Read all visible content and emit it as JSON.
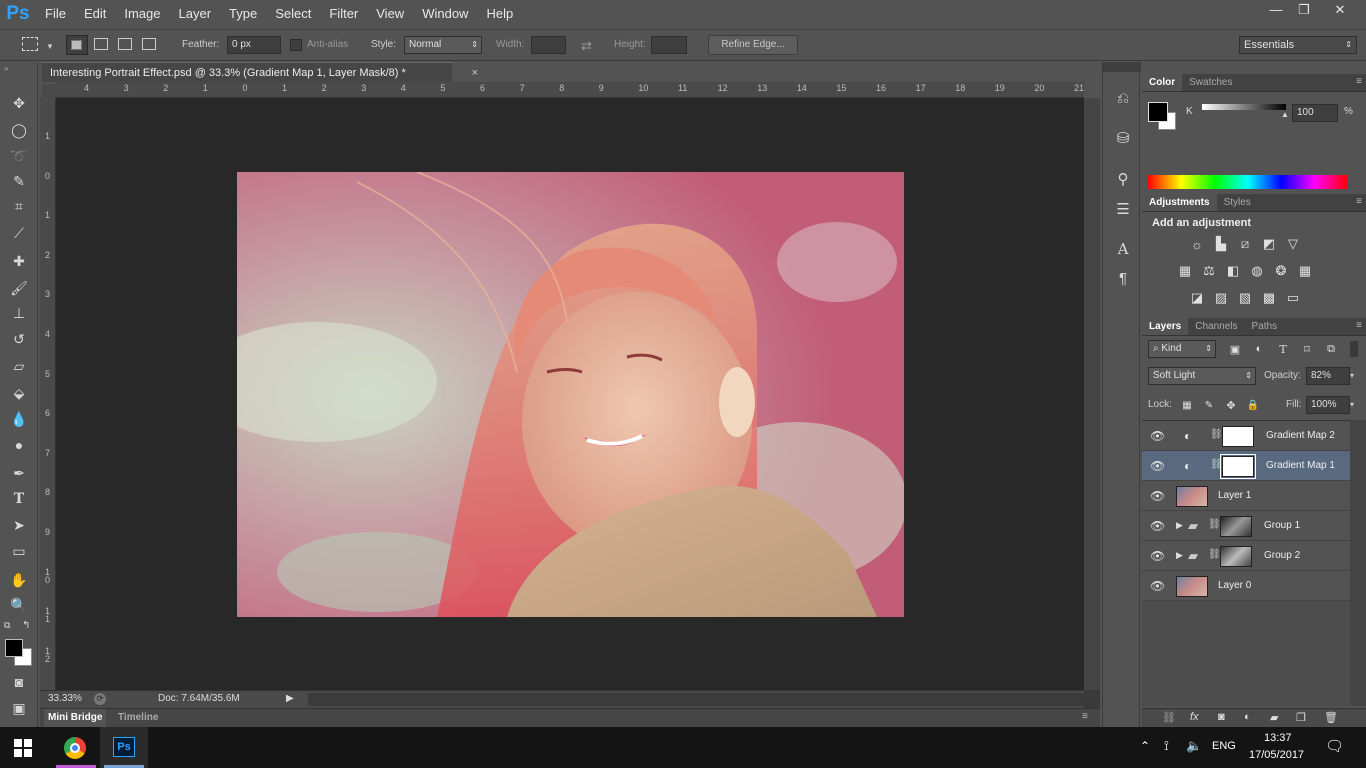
{
  "app": {
    "logo": "Ps"
  },
  "menu": [
    "File",
    "Edit",
    "Image",
    "Layer",
    "Type",
    "Select",
    "Filter",
    "View",
    "Window",
    "Help"
  ],
  "window_controls": {
    "minimize": "—",
    "restore": "❐",
    "close": "✕"
  },
  "options": {
    "feather_label": "Feather:",
    "feather_value": "0 px",
    "antialias_label": "Anti-alias",
    "style_label": "Style:",
    "style_value": "Normal",
    "width_label": "Width:",
    "height_label": "Height:",
    "refine_edge": "Refine Edge...",
    "workspace": "Essentials"
  },
  "document": {
    "tab_title": "Interesting Portrait Effect.psd @ 33.3% (Gradient Map 1, Layer Mask/8) *",
    "tab_close": "×",
    "ruler_top": [
      "4",
      "3",
      "2",
      "1",
      "0",
      "1",
      "2",
      "3",
      "4",
      "5",
      "6",
      "7",
      "8",
      "9",
      "10",
      "11",
      "12",
      "13",
      "14",
      "15",
      "16",
      "17",
      "18",
      "19",
      "20",
      "21"
    ],
    "ruler_left": [
      "1",
      "0",
      "1",
      "2",
      "3",
      "4",
      "5",
      "6",
      "7",
      "8",
      "9",
      "1\n0",
      "1\n1",
      "1\n2"
    ],
    "zoom": "33.33%",
    "doc_info": "Doc: 7.64M/35.6M"
  },
  "bottom_tabs": [
    "Mini Bridge",
    "Timeline"
  ],
  "color_panel": {
    "tabs": [
      "Color",
      "Swatches"
    ],
    "channel": "K",
    "value": "100",
    "unit": "%"
  },
  "adjustments_panel": {
    "tabs": [
      "Adjustments",
      "Styles"
    ],
    "title": "Add an adjustment"
  },
  "layers_panel": {
    "tabs": [
      "Layers",
      "Channels",
      "Paths"
    ],
    "filter_kind": "Kind",
    "blend_mode": "Soft Light",
    "opacity_label": "Opacity:",
    "opacity": "82%",
    "lock_label": "Lock:",
    "fill_label": "Fill:",
    "fill": "100%",
    "layers": [
      {
        "name": "Gradient Map 2",
        "type": "adjustment",
        "selected": false
      },
      {
        "name": "Gradient Map 1",
        "type": "adjustment",
        "selected": true
      },
      {
        "name": "Layer 1",
        "type": "pixel",
        "selected": false
      },
      {
        "name": "Group 1",
        "type": "group",
        "selected": false
      },
      {
        "name": "Group 2",
        "type": "group",
        "selected": false
      },
      {
        "name": "Layer 0",
        "type": "pixel",
        "selected": false
      }
    ],
    "footer_icons": [
      "link-icon",
      "fx-icon",
      "mask-icon",
      "adjustment-icon",
      "folder-icon",
      "new-layer-icon",
      "trash-icon"
    ]
  },
  "taskbar": {
    "language": "ENG",
    "time": "13:37",
    "date": "17/05/2017"
  },
  "colors": {
    "accent": "#2fa3ff",
    "selected_layer": "#596a80",
    "canvas_bg": "#282828"
  }
}
